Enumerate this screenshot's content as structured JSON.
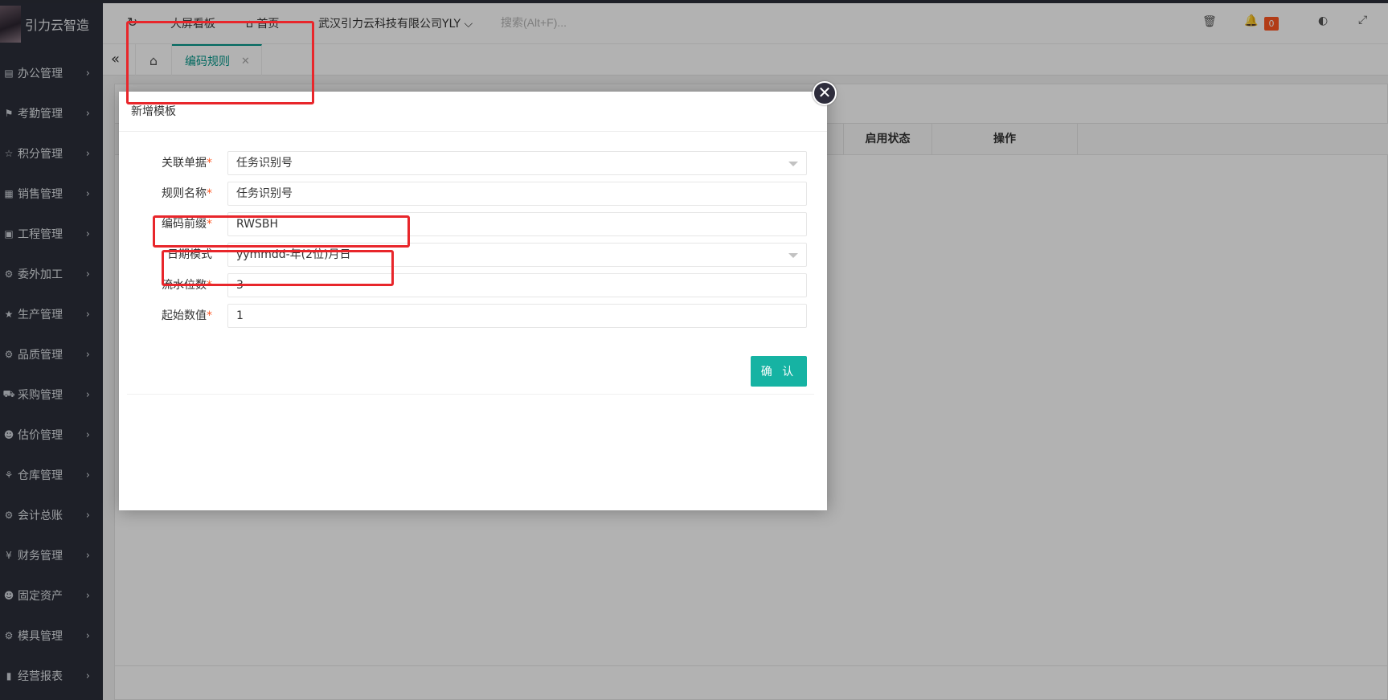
{
  "app": {
    "name": "引力云智造"
  },
  "sidebar": {
    "items": [
      {
        "label": "办公管理",
        "icon": "office-icon",
        "glyph": "▤"
      },
      {
        "label": "考勤管理",
        "icon": "flag-icon",
        "glyph": "⚑"
      },
      {
        "label": "积分管理",
        "icon": "star-icon",
        "glyph": "☆"
      },
      {
        "label": "销售管理",
        "icon": "sales-icon",
        "glyph": "▦"
      },
      {
        "label": "工程管理",
        "icon": "engineering-icon",
        "glyph": "▣"
      },
      {
        "label": "委外加工",
        "icon": "outsource-icon",
        "glyph": "⚙"
      },
      {
        "label": "生产管理",
        "icon": "production-star-icon",
        "glyph": "★"
      },
      {
        "label": "品质管理",
        "icon": "quality-icon",
        "glyph": "⚙"
      },
      {
        "label": "采购管理",
        "icon": "cart-icon",
        "glyph": "⛟"
      },
      {
        "label": "估价管理",
        "icon": "users-icon",
        "glyph": "☻"
      },
      {
        "label": "仓库管理",
        "icon": "warehouse-icon",
        "glyph": "⚘"
      },
      {
        "label": "会计总账",
        "icon": "ledger-icon",
        "glyph": "⚙"
      },
      {
        "label": "财务管理",
        "icon": "finance-icon",
        "glyph": "¥"
      },
      {
        "label": "固定资产",
        "icon": "assets-icon",
        "glyph": "☻"
      },
      {
        "label": "模具管理",
        "icon": "mold-icon",
        "glyph": "⚙"
      },
      {
        "label": "经营报表",
        "icon": "report-icon",
        "glyph": "▮"
      }
    ]
  },
  "header": {
    "refresh_icon": "refresh-icon",
    "big_screen": "大屏看板",
    "home": "首页",
    "company": "武汉引力云科技有限公司YLY",
    "search_placeholder": "搜索(Alt+F)...",
    "notification_count": "0"
  },
  "tabbar": {
    "tabs": [
      {
        "label": "编码规则",
        "active": true
      }
    ]
  },
  "table": {
    "headers": {
      "status": "启用状态",
      "operation": "操作"
    }
  },
  "dialog": {
    "title": "新增模板",
    "fields": {
      "linked_doc": {
        "label": "关联单据",
        "value": "任务识别号",
        "required": true
      },
      "rule_name": {
        "label": "规则名称",
        "value": "任务识别号",
        "required": true
      },
      "code_prefix": {
        "label": "编码前缀",
        "value": "RWSBH",
        "required": true
      },
      "date_mode": {
        "label": "日期模式",
        "value": "yymmdd-年(2位)月日",
        "required": false
      },
      "serial_digits": {
        "label": "流水位数",
        "value": "3",
        "required": true
      },
      "start_value": {
        "label": "起始数值",
        "value": "1",
        "required": true
      }
    },
    "confirm": "确 认",
    "required_mark": "*"
  },
  "colors": {
    "accent": "#009688",
    "confirm_button": "#16b3a3",
    "badge": "#ff5722",
    "annotation": "#e8262b",
    "sidebar_bg": "#2b2f3a"
  }
}
